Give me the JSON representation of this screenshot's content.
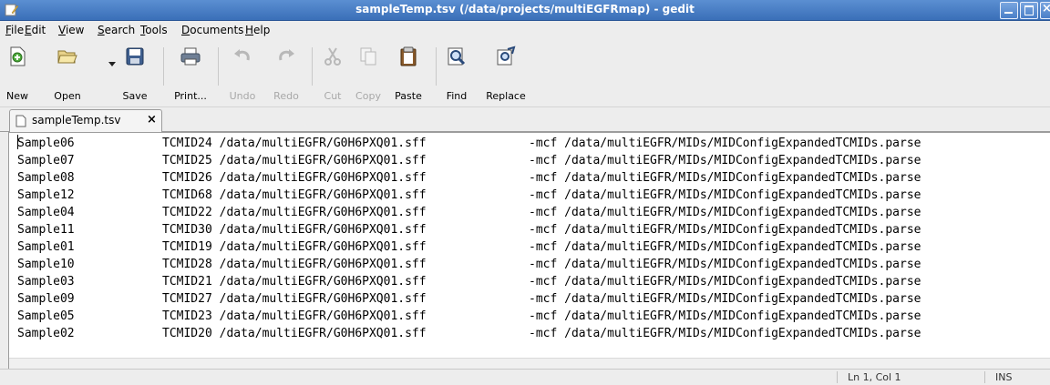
{
  "window": {
    "title": "sampleTemp.tsv (/data/projects/multiEGFRmap) - gedit"
  },
  "menu": [
    {
      "label": "File",
      "mnemonic": "F"
    },
    {
      "label": "Edit",
      "mnemonic": "E"
    },
    {
      "label": "View",
      "mnemonic": "V"
    },
    {
      "label": "Search",
      "mnemonic": "S"
    },
    {
      "label": "Tools",
      "mnemonic": "T"
    },
    {
      "label": "Documents",
      "mnemonic": "D"
    },
    {
      "label": "Help",
      "mnemonic": "H"
    }
  ],
  "toolbar": {
    "new": {
      "label": "New",
      "icon": "new-document-icon"
    },
    "open": {
      "label": "Open",
      "icon": "folder-open-icon"
    },
    "save": {
      "label": "Save",
      "icon": "floppy-disk-icon"
    },
    "print": {
      "label": "Print...",
      "icon": "printer-icon"
    },
    "undo": {
      "label": "Undo",
      "icon": "undo-icon",
      "disabled": true
    },
    "redo": {
      "label": "Redo",
      "icon": "redo-icon",
      "disabled": true
    },
    "cut": {
      "label": "Cut",
      "icon": "scissors-icon",
      "disabled": true
    },
    "copy": {
      "label": "Copy",
      "icon": "copy-icon",
      "disabled": true
    },
    "paste": {
      "label": "Paste",
      "icon": "clipboard-icon"
    },
    "find": {
      "label": "Find",
      "icon": "magnifier-icon"
    },
    "replace": {
      "label": "Replace",
      "icon": "find-replace-icon"
    }
  },
  "tab": {
    "label": "sampleTemp.tsv",
    "close": "×"
  },
  "editor": {
    "lines": [
      {
        "sample": "Sample06",
        "mid": "TCMID24 /data/multiEGFR/G0H6PXQ01.sff",
        "config": "-mcf /data/multiEGFR/MIDs/MIDConfigExpandedTCMIDs.parse"
      },
      {
        "sample": "Sample07",
        "mid": "TCMID25 /data/multiEGFR/G0H6PXQ01.sff",
        "config": "-mcf /data/multiEGFR/MIDs/MIDConfigExpandedTCMIDs.parse"
      },
      {
        "sample": "Sample08",
        "mid": "TCMID26 /data/multiEGFR/G0H6PXQ01.sff",
        "config": "-mcf /data/multiEGFR/MIDs/MIDConfigExpandedTCMIDs.parse"
      },
      {
        "sample": "Sample12",
        "mid": "TCMID68 /data/multiEGFR/G0H6PXQ01.sff",
        "config": "-mcf /data/multiEGFR/MIDs/MIDConfigExpandedTCMIDs.parse"
      },
      {
        "sample": "Sample04",
        "mid": "TCMID22 /data/multiEGFR/G0H6PXQ01.sff",
        "config": "-mcf /data/multiEGFR/MIDs/MIDConfigExpandedTCMIDs.parse"
      },
      {
        "sample": "Sample11",
        "mid": "TCMID30 /data/multiEGFR/G0H6PXQ01.sff",
        "config": "-mcf /data/multiEGFR/MIDs/MIDConfigExpandedTCMIDs.parse"
      },
      {
        "sample": "Sample01",
        "mid": "TCMID19 /data/multiEGFR/G0H6PXQ01.sff",
        "config": "-mcf /data/multiEGFR/MIDs/MIDConfigExpandedTCMIDs.parse"
      },
      {
        "sample": "Sample10",
        "mid": "TCMID28 /data/multiEGFR/G0H6PXQ01.sff",
        "config": "-mcf /data/multiEGFR/MIDs/MIDConfigExpandedTCMIDs.parse"
      },
      {
        "sample": "Sample03",
        "mid": "TCMID21 /data/multiEGFR/G0H6PXQ01.sff",
        "config": "-mcf /data/multiEGFR/MIDs/MIDConfigExpandedTCMIDs.parse"
      },
      {
        "sample": "Sample09",
        "mid": "TCMID27 /data/multiEGFR/G0H6PXQ01.sff",
        "config": "-mcf /data/multiEGFR/MIDs/MIDConfigExpandedTCMIDs.parse"
      },
      {
        "sample": "Sample05",
        "mid": "TCMID23 /data/multiEGFR/G0H6PXQ01.sff",
        "config": "-mcf /data/multiEGFR/MIDs/MIDConfigExpandedTCMIDs.parse"
      },
      {
        "sample": "Sample02",
        "mid": "TCMID20 /data/multiEGFR/G0H6PXQ01.sff",
        "config": "-mcf /data/multiEGFR/MIDs/MIDConfigExpandedTCMIDs.parse"
      }
    ]
  },
  "status": {
    "position": "Ln 1, Col 1",
    "mode": "INS"
  },
  "colors": {
    "titlebar": "#3a6fb8",
    "chrome": "#ededed",
    "editor_bg": "#ffffff",
    "disabled_text": "#a8a8a8"
  }
}
